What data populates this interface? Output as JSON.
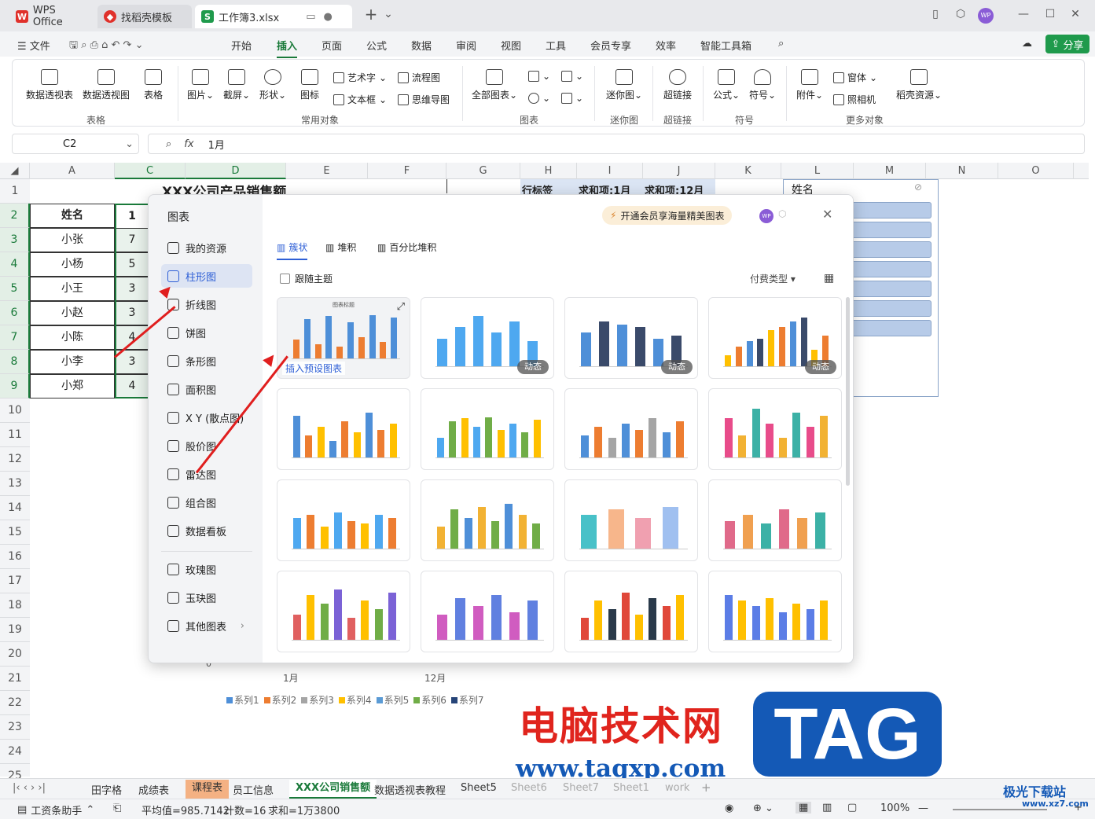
{
  "titlebar": {
    "tabs": [
      "WPS Office",
      "找稻壳模板",
      "工作簿3.xlsx"
    ],
    "add": "+"
  },
  "menu": {
    "file": "文件",
    "items": [
      "开始",
      "插入",
      "页面",
      "公式",
      "数据",
      "审阅",
      "视图",
      "工具",
      "会员专享",
      "效率",
      "智能工具箱"
    ],
    "active": "插入",
    "share": "分享"
  },
  "ribbon": {
    "big": [
      "数据透视表",
      "数据透视图",
      "表格",
      "图片",
      "截屏",
      "形状",
      "图标",
      "全部图表",
      "迷你图",
      "超链接",
      "公式",
      "符号",
      "附件",
      "稻壳资源"
    ],
    "small": [
      "艺术字",
      "流程图",
      "文本框",
      "思维导图",
      "窗体",
      "照相机"
    ],
    "groups": [
      "表格",
      "常用对象",
      "图表",
      "迷你图",
      "超链接",
      "符号",
      "更多对象"
    ]
  },
  "formula": {
    "namebox": "C2",
    "fx": "fx",
    "value": "1月"
  },
  "grid": {
    "cols": [
      "A",
      "C",
      "D",
      "E",
      "F",
      "G",
      "H",
      "I",
      "J",
      "K",
      "L",
      "M",
      "N",
      "O"
    ],
    "rows": [
      "1",
      "2",
      "3",
      "4",
      "5",
      "6",
      "7",
      "8",
      "9",
      "10",
      "11",
      "12",
      "13",
      "14",
      "15",
      "16",
      "17",
      "18",
      "19",
      "20",
      "21",
      "22",
      "23",
      "24",
      "25"
    ],
    "title": "XXX公司产品销售额",
    "header": "姓名",
    "c2": "1",
    "names": [
      "小张",
      "小杨",
      "小王",
      "小赵",
      "小陈",
      "小李",
      "小郑"
    ],
    "cvals": [
      "7",
      "5",
      "3",
      "3",
      "4",
      "3",
      "4"
    ],
    "pivot": [
      "行标签",
      "求和项:1月",
      "求和项:12月"
    ],
    "slicer": "姓名",
    "chart_axis": [
      "0",
      "1月",
      "12月"
    ],
    "legend": [
      "系列1",
      "系列2",
      "系列3",
      "系列4",
      "系列5",
      "系列6",
      "系列7"
    ],
    "colors": [
      "#4e8fd8",
      "#ed7d31",
      "#a5a5a5",
      "#ffc000",
      "#5b9bd5",
      "#70ad47",
      "#264478"
    ]
  },
  "dialog": {
    "title": "图表",
    "promo": "开通会员享海量精美图表",
    "sidebar": [
      "我的资源",
      "柱形图",
      "折线图",
      "饼图",
      "条形图",
      "面积图",
      "X Y (散点图)",
      "股价图",
      "雷达图",
      "组合图",
      "数据看板",
      "玫瑰图",
      "玉玦图",
      "其他图表"
    ],
    "selected": "柱形图",
    "subtabs": [
      "簇状",
      "堆积",
      "百分比堆积"
    ],
    "follow": "跟随主题",
    "paytype": "付费类型",
    "insert": "插入预设图表",
    "dynamic": "动态",
    "thumb_title": "图表标题"
  },
  "sheets": [
    "田字格",
    "成绩表",
    "课程表",
    "员工信息",
    "XXX公司销售额",
    "数据透视表教程",
    "Sheet5",
    "Sheet6",
    "Sheet7",
    "Sheet1",
    "work"
  ],
  "active_sheet": "XXX公司销售额",
  "status": {
    "helper": "工资条助手",
    "avg": "平均值=985.7142",
    "count": "计数=16",
    "sum": "求和=1万3800",
    "zoom": "100%"
  },
  "watermark": {
    "cn": "电脑技术网",
    "url": "www.tagxp.com",
    "tag": "TAG",
    "site": "极光下载站",
    "site_url": "www.xz7.com"
  }
}
